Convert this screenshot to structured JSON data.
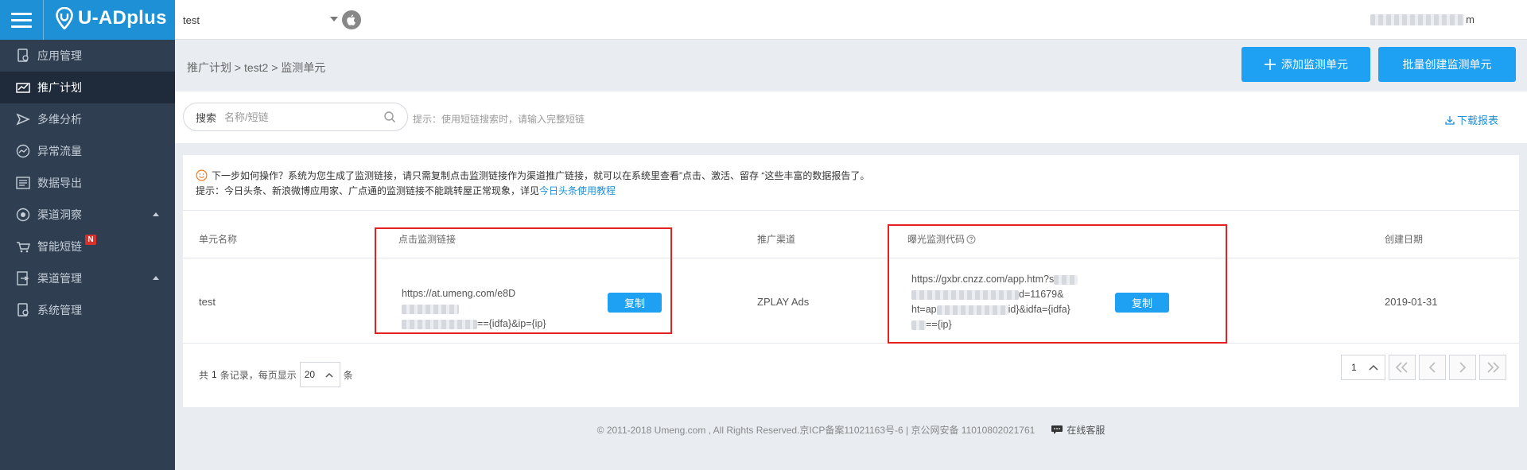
{
  "brand": {
    "name": "U-ADplus"
  },
  "header": {
    "app_selected": "test",
    "user": "m"
  },
  "sidebar": {
    "items": [
      {
        "label": "应用管理",
        "icon": "app-icon"
      },
      {
        "label": "推广计划",
        "icon": "campaign-icon"
      },
      {
        "label": "多维分析",
        "icon": "analysis-icon"
      },
      {
        "label": "异常流量",
        "icon": "anomaly-icon"
      },
      {
        "label": "数据导出",
        "icon": "export-icon"
      },
      {
        "label": "渠道洞察",
        "icon": "insight-icon"
      },
      {
        "label": "智能短链",
        "icon": "shortlink-icon",
        "badge": "N"
      },
      {
        "label": "渠道管理",
        "icon": "channel-icon"
      },
      {
        "label": "系统管理",
        "icon": "system-icon"
      }
    ]
  },
  "breadcrumb": "推广计划 > test2 > 监测单元",
  "actions": {
    "add_label": "添加监测单元",
    "batch_label": "批量创建监测单元"
  },
  "search": {
    "label": "搜索",
    "placeholder": "名称/短链",
    "hint": "提示：使用短链搜索时，请输入完整短链",
    "download_label": "下载报表"
  },
  "tips": {
    "line1": "下一步如何操作？系统为您生成了监测链接，请只需复制点击监测链接作为渠道推广链接，就可以在系统里查看”点击、激活、留存 “这些丰富的数据报告了。",
    "line2_prefix": "提示：今日头条、新浪微博应用家、广点通的监测链接不能跳转屋正常现象，详见",
    "line2_link": "今日头条使用教程"
  },
  "table": {
    "columns": [
      "单元名称",
      "点击监测链接",
      "推广渠道",
      "曝光监测代码",
      "创建日期"
    ],
    "rows": [
      {
        "name": "test",
        "click_link_l1": "https://at.umeng.com/e8D",
        "click_link_l2": "=={idfa}&ip={ip}",
        "channel": "ZPLAY Ads",
        "imp_l1": "https://gxbr.cnzz.com/app.htm?s",
        "imp_l2": "d=11679&",
        "imp_l3_a": "ht=ap",
        "imp_l3_b": "id}&idfa={idfa}",
        "imp_l4": "=={ip}",
        "date": "2019-01-31",
        "copy_label": "复制"
      }
    ]
  },
  "pagination": {
    "prefix": "共",
    "total": "1",
    "mid": "条记录，每页显示",
    "page_size": "20",
    "suffix": "条",
    "current_page": "1"
  },
  "footer": {
    "copyright": "© 2011-2018 Umeng.com , All Rights Reserved.京ICP备案11021163号-6 | 京公网安备 11010802021761",
    "service": "在线客服"
  },
  "colors": {
    "brand": "#1e90d6",
    "button": "#1ea1f2",
    "sidebar": "#2f3e50",
    "highlight_frame": "#e52020"
  }
}
